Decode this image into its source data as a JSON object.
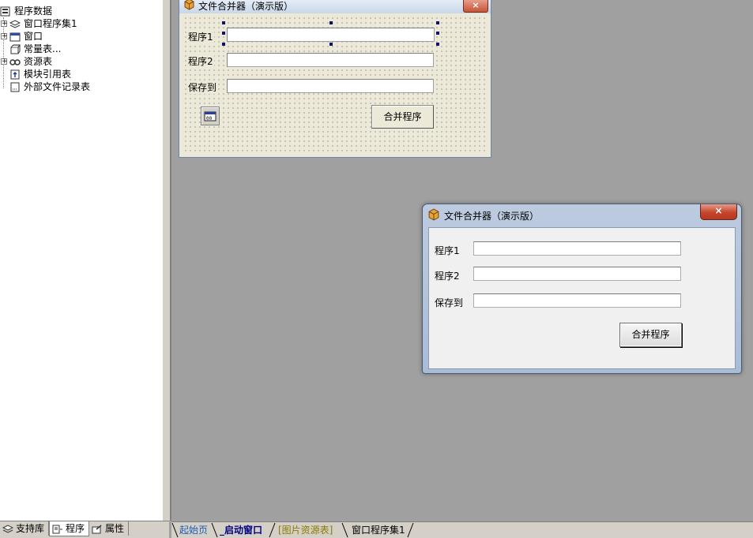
{
  "project_tree": {
    "root": {
      "label": "程序数据",
      "icon": "database-icon"
    },
    "items": [
      {
        "label": "窗口程序集1",
        "icon": "layers-icon",
        "expandable": true
      },
      {
        "label": "窗口",
        "icon": "window-icon",
        "expandable": true
      },
      {
        "label": "常量表...",
        "icon": "constants-icon",
        "expandable": false
      },
      {
        "label": "资源表",
        "icon": "resources-icon",
        "expandable": true
      },
      {
        "label": "模块引用表",
        "icon": "module-ref-icon",
        "expandable": false
      },
      {
        "label": "外部文件记录表",
        "icon": "external-file-icon",
        "expandable": false
      }
    ]
  },
  "left_tabs": [
    {
      "label": "支持库",
      "icon": "library-icon"
    },
    {
      "label": "程序",
      "icon": "program-icon"
    },
    {
      "label": "属性",
      "icon": "properties-icon"
    }
  ],
  "design_form": {
    "title": "文件合并器（演示版）",
    "close_label": "×",
    "label_prog1": "程序1",
    "label_prog2": "程序2",
    "label_save": "保存到",
    "merge_button": "合并程序"
  },
  "preview_window": {
    "title": "文件合并器（演示版）",
    "close_label": "×",
    "label_prog1": "程序1",
    "label_prog2": "程序2",
    "label_save": "保存到",
    "merge_button": "合并程序"
  },
  "editor_tabs": [
    {
      "label": "起始页",
      "color": "#1a5fb4",
      "bold": false
    },
    {
      "label": "_启动窗口",
      "color": "#000080",
      "bold": true
    },
    {
      "label": "[图片资源表]",
      "color": "#8a7a00",
      "bold": false
    },
    {
      "label": "窗口程序集1",
      "color": "#000000",
      "bold": false
    }
  ],
  "colors": {
    "workspace": "#a0a0a0",
    "panel": "#d4d0c8",
    "close_button": "#c75437"
  }
}
